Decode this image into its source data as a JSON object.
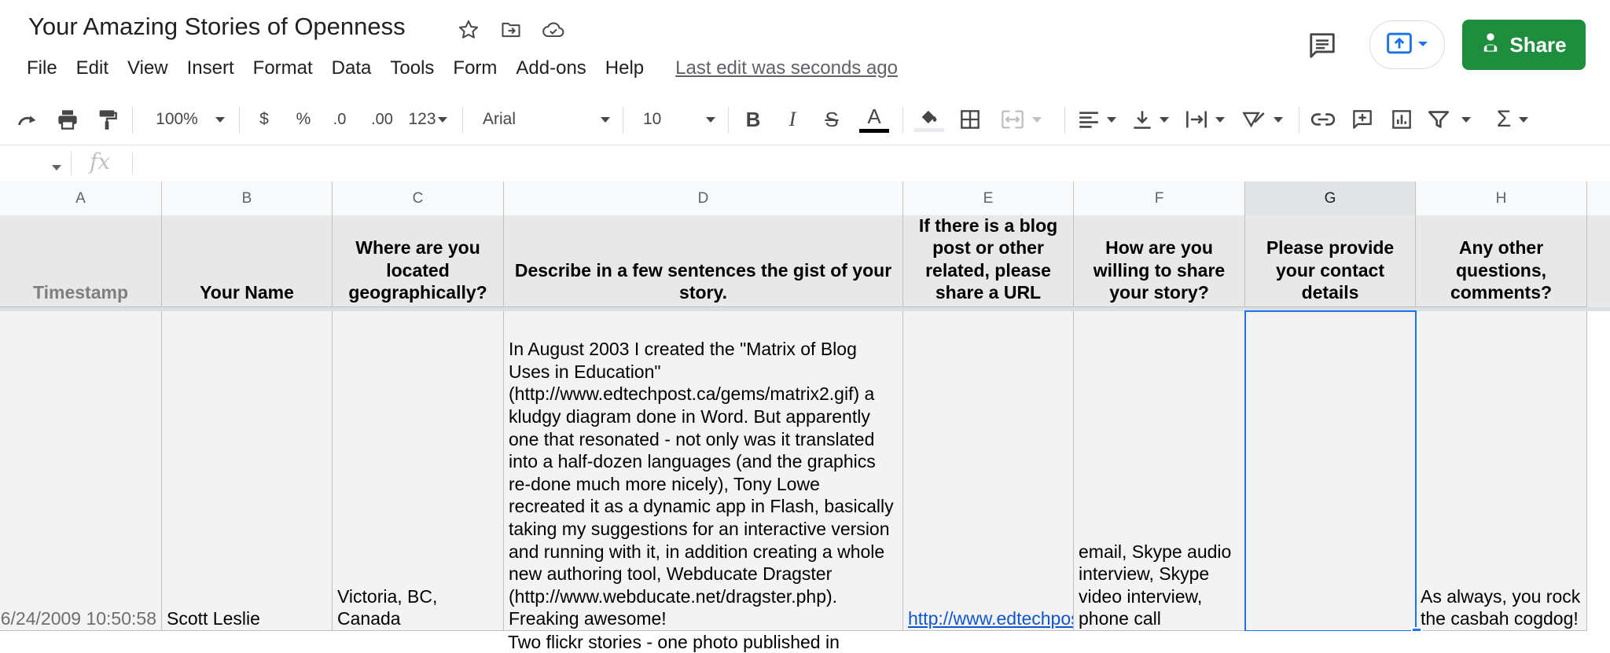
{
  "app": {
    "doc_title": "Your Amazing Stories of Openness",
    "last_edit": "Last edit was seconds ago",
    "share_label": "Share"
  },
  "menu": [
    "File",
    "Edit",
    "View",
    "Insert",
    "Format",
    "Data",
    "Tools",
    "Form",
    "Add-ons",
    "Help"
  ],
  "toolbar": {
    "zoom": "100%",
    "currency": "$",
    "percent": "%",
    "decrease_decimal": ".0",
    "increase_decimal": ".00",
    "more_formats": "123",
    "font": "Arial",
    "font_size": "10",
    "bold": "B",
    "italic": "I",
    "strike": "S",
    "text_color": "A"
  },
  "formula_bar": {
    "fx": "fx"
  },
  "columns": [
    "A",
    "B",
    "C",
    "D",
    "E",
    "F",
    "G",
    "H"
  ],
  "selected_column": "G",
  "header_row": [
    "Timestamp",
    "Your Name",
    "Where are you located geographically?",
    "Describe in a few sentences the gist of your story.",
    "If there is a blog post or other related, please share a URL",
    "How are you willing to share your story?",
    "Please provide your contact details",
    "Any other questions, comments?"
  ],
  "data_row": {
    "timestamp": "6/24/2009 10:50:58",
    "name": "Scott Leslie",
    "location": "Victoria, BC, Canada",
    "story": "In August 2003 I created the \"Matrix of Blog Uses in Education\" (http://www.edtechpost.ca/gems/matrix2.gif) a kludgy diagram done in Word. But apparently one that resonated - not only was it translated into a half-dozen languages (and the graphics re-done much more nicely), Tony Lowe recreated it as a dynamic app in Flash, basically taking my suggestions for an interactive version and running with it, in addition creating a whole new authoring tool, Webducate Dragster (http://www.webducate.net/dragster.php). Freaking awesome!",
    "url": "http://www.edtechpost.ca",
    "share_methods": "email, Skype audio interview, Skype video interview, phone call",
    "contact": "",
    "comments": "As always, you rock the casbah cogdog!"
  },
  "next_row_preview": "Two flickr stories - one photo published in",
  "colors": {
    "share_green": "#1e8e3e",
    "selection_blue": "#1a73e8",
    "link_blue": "#1155cc"
  },
  "icons": [
    "star-icon",
    "move-to-folder-icon",
    "cloud-saved-icon",
    "comment-history-icon",
    "present-icon",
    "lock-person-icon"
  ]
}
